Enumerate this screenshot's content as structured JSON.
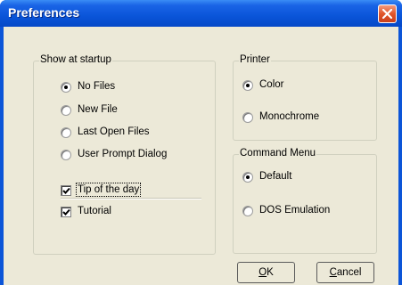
{
  "window": {
    "title": "Preferences"
  },
  "startup": {
    "legend": "Show at startup",
    "options": [
      {
        "label": "No Files",
        "selected": true
      },
      {
        "label": "New File",
        "selected": false
      },
      {
        "label": "Last Open Files",
        "selected": false
      },
      {
        "label": "User Prompt Dialog",
        "selected": false
      }
    ],
    "checks": [
      {
        "label": "Tip of the day",
        "checked": true
      },
      {
        "label": "Tutorial",
        "checked": true
      }
    ]
  },
  "printer": {
    "legend": "Printer",
    "options": [
      {
        "label": "Color",
        "selected": true
      },
      {
        "label": "Monochrome",
        "selected": false
      }
    ]
  },
  "command_menu": {
    "legend": "Command Menu",
    "options": [
      {
        "label": "Default",
        "selected": true
      },
      {
        "label": "DOS Emulation",
        "selected": false
      }
    ]
  },
  "buttons": {
    "ok_mnemonic": "O",
    "ok_rest": "K",
    "cancel_mnemonic": "C",
    "cancel_rest": "ancel"
  },
  "icons": {
    "close": "close-icon"
  },
  "colors": {
    "titlebar": "#0a55d9",
    "close": "#e0552a",
    "dialog_bg": "#ece9d8"
  }
}
